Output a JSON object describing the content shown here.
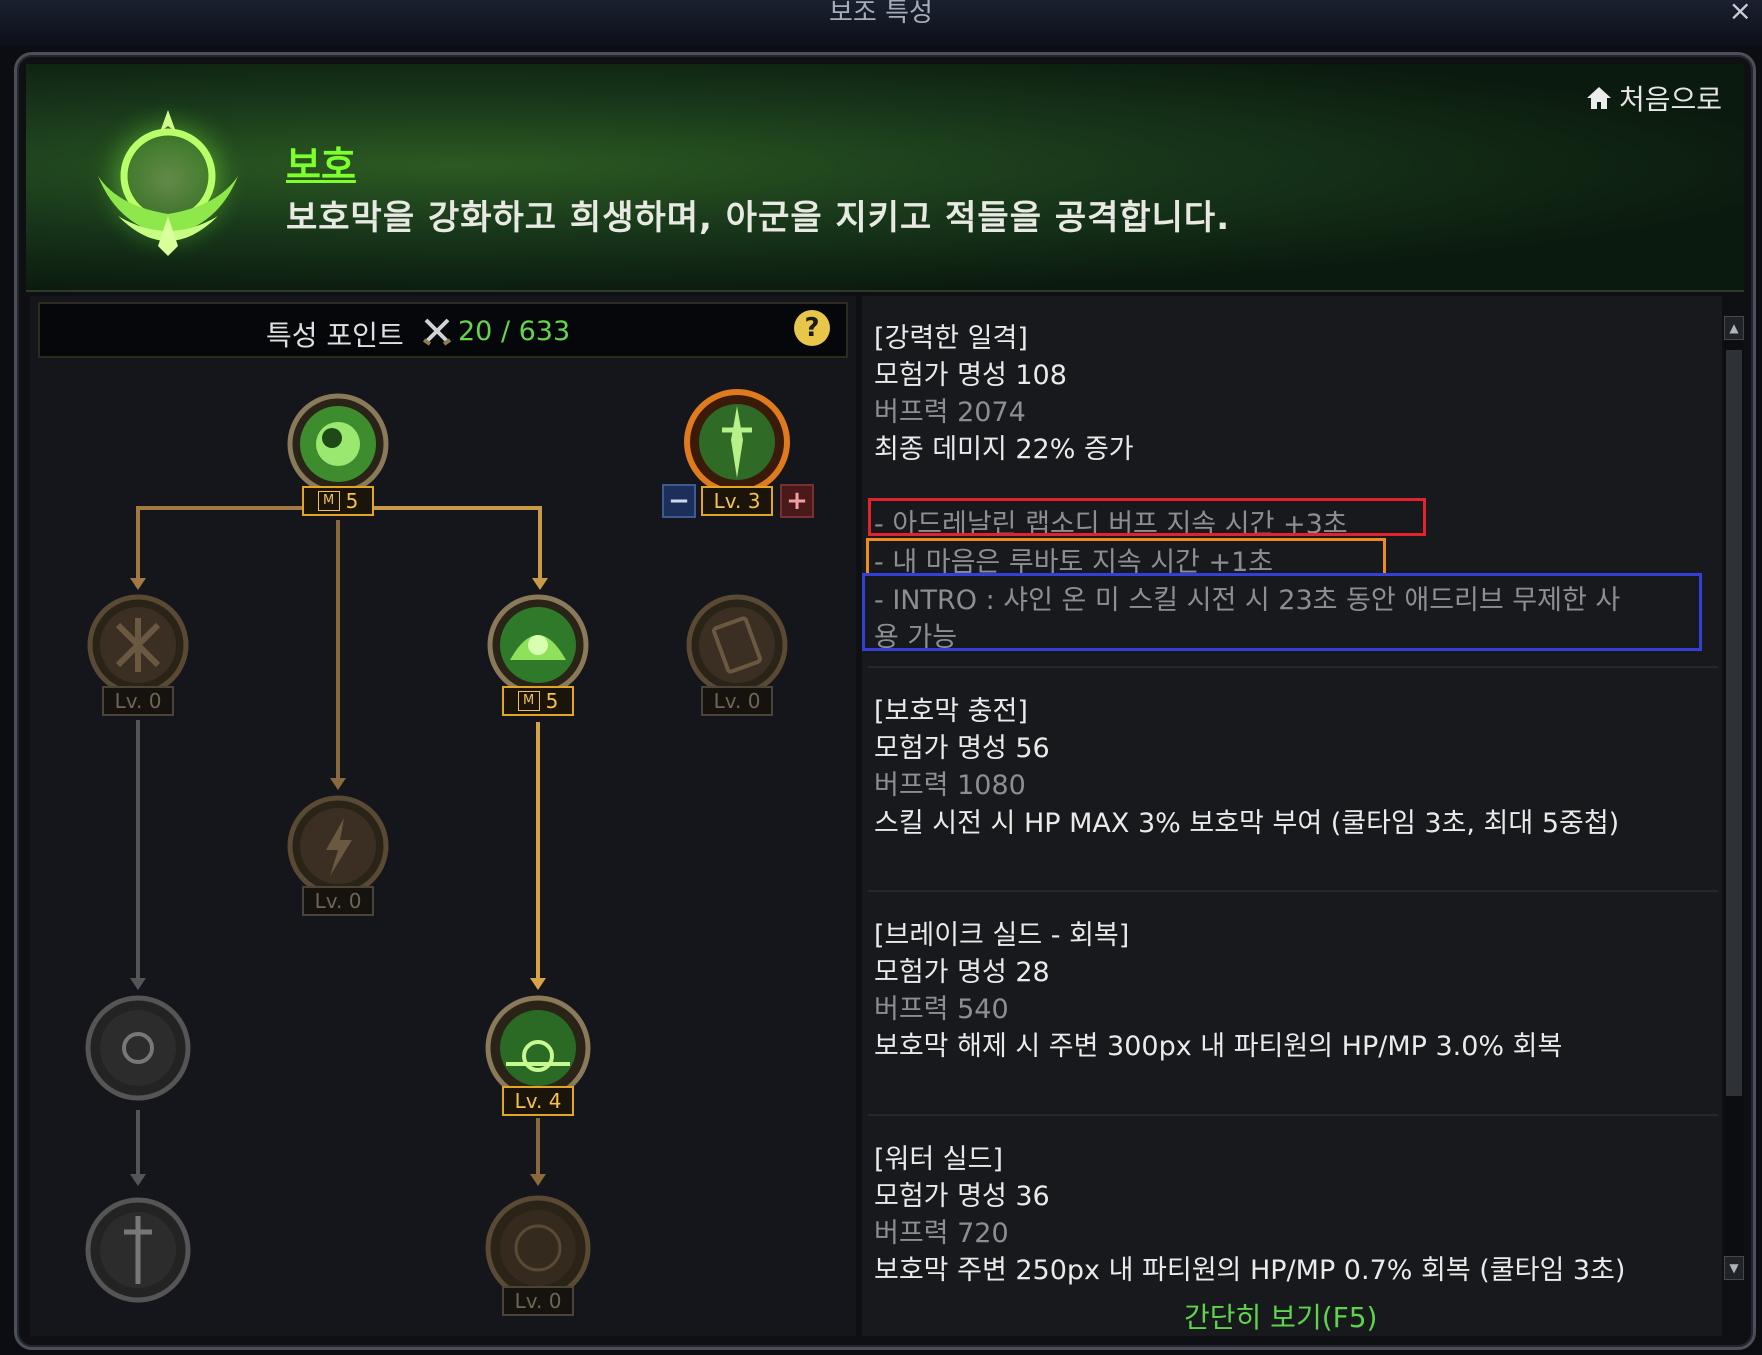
{
  "window": {
    "title": "보조 특성",
    "close": "×"
  },
  "header": {
    "home_label": "처음으로",
    "class_title": "보호",
    "class_desc": "보호막을 강화하고 희생하며, 아군을 지키고 적들을 공격합니다."
  },
  "points": {
    "label": "특성 포인트",
    "value": "20 / 633",
    "help": "?"
  },
  "tree": {
    "nodes": [
      {
        "badge": "5",
        "prefix": "M"
      },
      {
        "badge": "Lv. 3"
      },
      {
        "badge": "Lv. 0"
      },
      {
        "badge": "5",
        "prefix": "M"
      },
      {
        "badge": "Lv. 0"
      },
      {
        "badge": "Lv. 0"
      },
      {
        "badge": "Lv. 4"
      },
      {
        "badge": "Lv. 0"
      }
    ],
    "minus": "−",
    "plus": "+"
  },
  "skills": [
    {
      "name": "[강력한 일격]",
      "renown": "모험가 명성 108",
      "buff": "버프력 2074",
      "effect": "최종 데미지 22% 증가",
      "notes": [
        "- 아드레날린 랩소디 버프 지속 시간 +3초",
        "- 내 마음은 루바토 지속 시간 +1초",
        "- INTRO : 샤인 온 미 스킬 시전 시 23초 동안 애드리브 무제한 사",
        "용 가능"
      ]
    },
    {
      "name": "[보호막 충전]",
      "renown": "모험가 명성 56",
      "buff": "버프력 1080",
      "effect": "스킬 시전 시 HP MAX 3% 보호막 부여 (쿨타임 3초, 최대 5중첩)"
    },
    {
      "name": "[브레이크 실드 - 회복]",
      "renown": "모험가 명성 28",
      "buff": "버프력 540",
      "effect": "보호막 해제 시 주변 300px 내 파티원의 HP/MP 3.0% 회복"
    },
    {
      "name": "[워터 실드]",
      "renown": "모험가 명성 36",
      "buff": "버프력 720",
      "effect": "보호막 주변 250px 내 파티원의 HP/MP 0.7% 회복 (쿨타임 3초)"
    }
  ],
  "footer": {
    "simple_view": "간단히 보기(F5)"
  },
  "colors": {
    "accent_green": "#5dd44a",
    "highlight_red": "#e2232e",
    "highlight_orange": "#f08b22",
    "highlight_blue": "#3340d8",
    "badge_gold": "#e2a524"
  }
}
